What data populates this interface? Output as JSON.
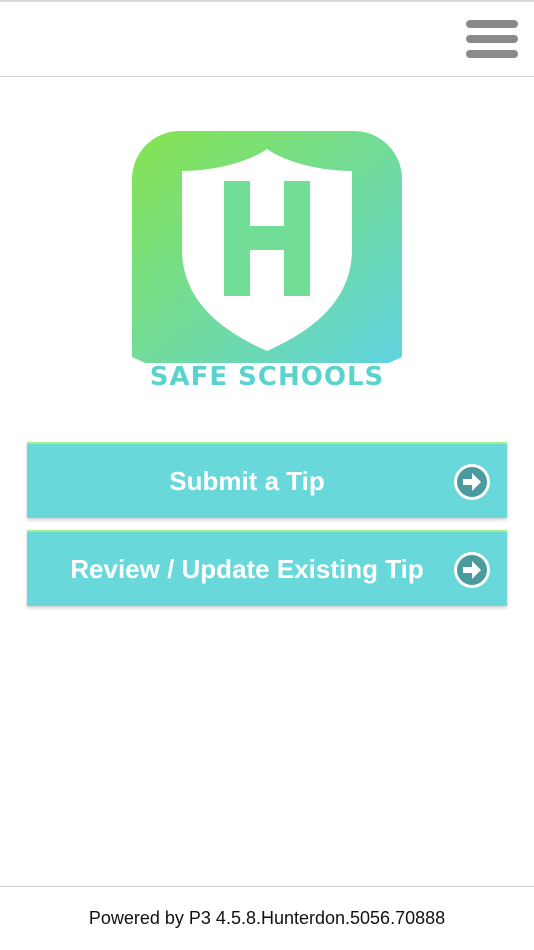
{
  "header": {
    "menu_icon": "hamburger-menu-icon"
  },
  "logo": {
    "letter": "H",
    "caption": "SAFE SCHOOLS",
    "gradient_start": "#86e44f",
    "gradient_end": "#5fd3e0",
    "caption_color": "#59d3cc"
  },
  "actions": [
    {
      "label": "Submit a Tip",
      "icon": "arrow-right-circle-icon"
    },
    {
      "label": "Review / Update Existing Tip",
      "icon": "arrow-right-circle-icon"
    }
  ],
  "colors": {
    "button_bg": "#68d8db",
    "button_top_border": "#a6ee8c",
    "arrow_circle": "#ffffff",
    "arrow_fill": "#4a9aa0",
    "menu_icon": "#8a8a8a"
  },
  "footer": {
    "text": "Powered by P3 4.5.8.Hunterdon.5056.70888"
  }
}
